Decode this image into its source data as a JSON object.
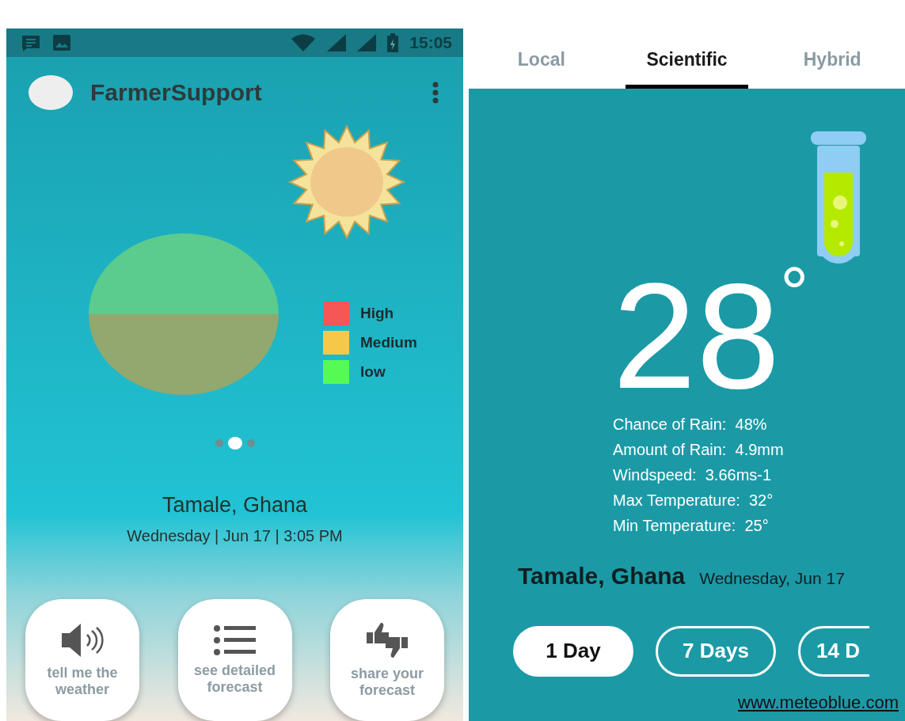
{
  "left_phone": {
    "status_bar": {
      "time": "15:05"
    },
    "app_bar": {
      "title": "FarmerSupport"
    },
    "legend": [
      {
        "label": "High",
        "color": "#f55656"
      },
      {
        "label": "Medium",
        "color": "#f5c84a"
      },
      {
        "label": "low",
        "color": "#55fa55"
      }
    ],
    "pager": [
      {
        "selected": false
      },
      {
        "selected": true
      },
      {
        "selected": false
      }
    ],
    "location": "Tamale, Ghana",
    "datetime": "Wednesday | Jun 17 | 3:05 PM",
    "actions": [
      {
        "kind": "speaker",
        "label": "tell me the weather"
      },
      {
        "kind": "list",
        "label": "see detailed forecast"
      },
      {
        "kind": "thumbs",
        "label": "share your forecast"
      }
    ]
  },
  "right_phone": {
    "tabs": [
      {
        "label": "Local",
        "selected": false
      },
      {
        "label": "Scientific",
        "selected": true
      },
      {
        "label": "Hybrid",
        "selected": false
      }
    ],
    "temperature": "28",
    "degree": "°",
    "details": [
      {
        "label": "Chance of Rain:",
        "value": "48%"
      },
      {
        "label": "Amount of Rain:",
        "value": "4.9mm"
      },
      {
        "label": "Windspeed:",
        "value": "3.66ms-1"
      },
      {
        "label": "Max Temperature:",
        "value": "32°"
      },
      {
        "label": "Min Temperature:",
        "value": "25°"
      }
    ],
    "location": "Tamale, Ghana",
    "date": "Wednesday, Jun 17",
    "ranges": [
      {
        "label": "1 Day",
        "selected": true
      },
      {
        "label": "7 Days",
        "selected": false
      },
      {
        "label": "14 D",
        "selected": false
      }
    ],
    "source_link": "www.meteoblue.com"
  }
}
